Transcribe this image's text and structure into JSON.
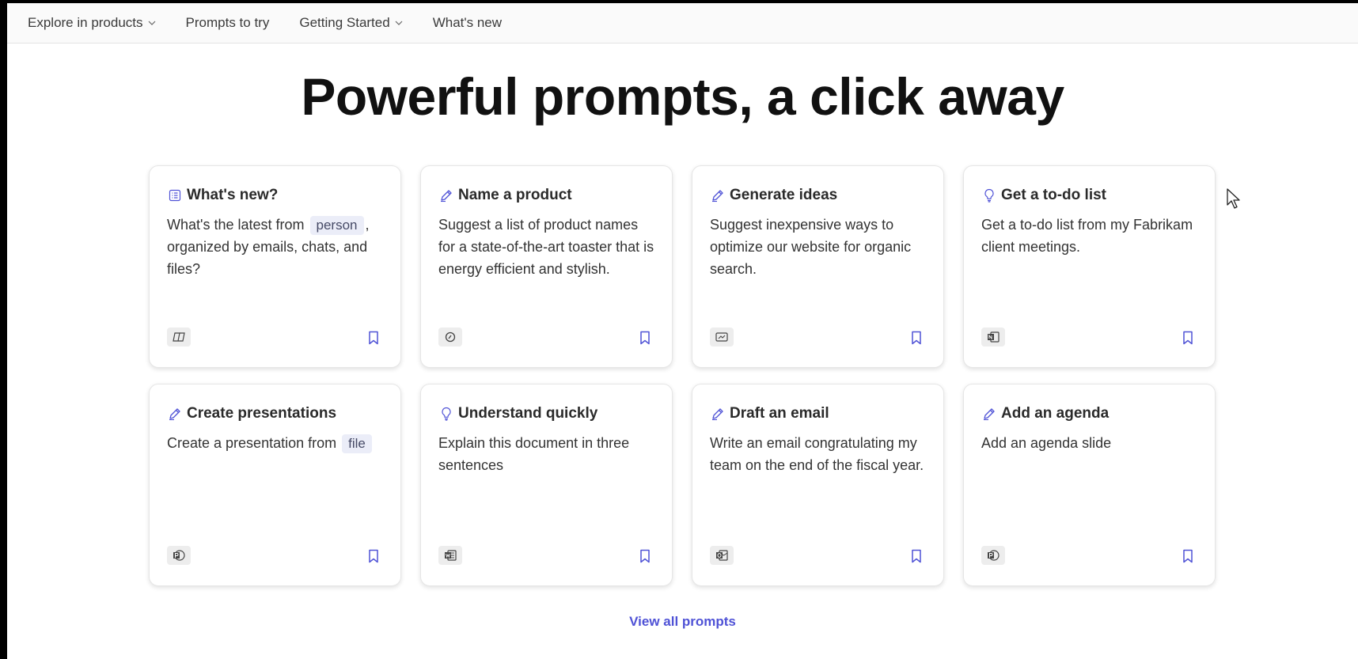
{
  "nav": {
    "items": [
      {
        "label": "Explore in products",
        "has_dropdown": true
      },
      {
        "label": "Prompts to try",
        "has_dropdown": false
      },
      {
        "label": "Getting Started",
        "has_dropdown": true
      },
      {
        "label": "What's new",
        "has_dropdown": false
      }
    ]
  },
  "hero": {
    "title": "Powerful prompts, a click away"
  },
  "cards": [
    {
      "title": "What's new?",
      "title_icon": "list-icon",
      "body_before": "What's the latest from",
      "chip": "person",
      "body_after": ", organized by emails, chats, and files?",
      "app_icon": "copilot-icon"
    },
    {
      "title": "Name a product",
      "title_icon": "pen-icon",
      "body_before": "Suggest a list of product names for a state-of-the-art toaster that is energy efficient and stylish.",
      "chip": "",
      "body_after": "",
      "app_icon": "loop-icon"
    },
    {
      "title": "Generate ideas",
      "title_icon": "pen-icon",
      "body_before": "Suggest inexpensive ways to optimize our website for organic search.",
      "chip": "",
      "body_after": "",
      "app_icon": "whiteboard-icon"
    },
    {
      "title": "Get a to-do list",
      "title_icon": "lightbulb-icon",
      "body_before": "Get a to-do list from my Fabrikam client meetings.",
      "chip": "",
      "body_after": "",
      "app_icon": "onenote-icon"
    },
    {
      "title": "Create presentations",
      "title_icon": "pen-icon",
      "body_before": "Create a presentation from",
      "chip": "file",
      "body_after": "",
      "app_icon": "powerpoint-icon"
    },
    {
      "title": "Understand quickly",
      "title_icon": "lightbulb-icon",
      "body_before": "Explain this document in three sentences",
      "chip": "",
      "body_after": "",
      "app_icon": "word-icon"
    },
    {
      "title": "Draft an email",
      "title_icon": "pen-icon",
      "body_before": "Write an email congratulating my team on the end of the fiscal year.",
      "chip": "",
      "body_after": "",
      "app_icon": "outlook-icon"
    },
    {
      "title": "Add an agenda",
      "title_icon": "pen-icon",
      "body_before": "Add an agenda slide",
      "chip": "",
      "body_after": "",
      "app_icon": "powerpoint-icon"
    }
  ],
  "footer": {
    "view_all_label": "View all prompts"
  },
  "colors": {
    "accent": "#4f52d6",
    "chip_bg": "#ebedf8",
    "nav_bg": "#fafafa"
  }
}
